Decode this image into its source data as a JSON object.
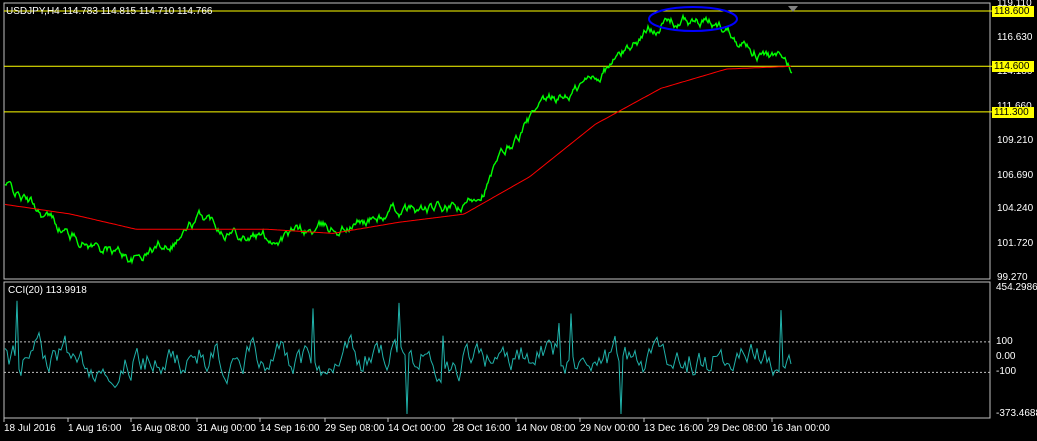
{
  "chart": {
    "symbol_header": "USDJPY,H4  114.783 114.815 114.710 114.766",
    "indicator_header": "CCI(20) 113.9918"
  },
  "price_axis": {
    "ticks": [
      "119.110",
      "116.630",
      "114.180",
      "111.660",
      "109.210",
      "106.690",
      "104.240",
      "101.720",
      "99.270"
    ]
  },
  "horizontal_lines": [
    {
      "label": "118.600",
      "price": 118.6,
      "color": "#ffff00"
    },
    {
      "label": "114.600",
      "price": 114.6,
      "color": "#ffff00"
    },
    {
      "label": "111.300",
      "price": 111.3,
      "color": "#ffff00"
    }
  ],
  "cci_axis": {
    "ticks": [
      "454.2986",
      "100",
      "0.00",
      "-100",
      "-373.4688"
    ]
  },
  "time_axis": {
    "labels": [
      "18 Jul 2016",
      "1 Aug 16:00",
      "16 Aug 08:00",
      "31 Aug 00:00",
      "14 Sep 16:00",
      "29 Sep 08:00",
      "14 Oct 00:00",
      "28 Oct 16:00",
      "14 Nov 08:00",
      "29 Nov 00:00",
      "13 Dec 16:00",
      "29 Dec 08:00",
      "16 Jan 00:00"
    ]
  },
  "colors": {
    "background": "#000000",
    "price_line": "#00ff00",
    "moving_average": "#ff0000",
    "cci_line": "#20b2aa",
    "levels": "#ffff00",
    "annotation": "#0000ff",
    "grid_border": "#c0c0c0"
  },
  "chart_data": {
    "type": "line",
    "title": "USDJPY,H4",
    "x": [
      "18 Jul 2016",
      "1 Aug 16:00",
      "16 Aug 08:00",
      "31 Aug 00:00",
      "14 Sep 16:00",
      "29 Sep 08:00",
      "14 Oct 00:00",
      "28 Oct 16:00",
      "14 Nov 08:00",
      "29 Nov 00:00",
      "13 Dec 16:00",
      "29 Dec 08:00",
      "16 Jan 00:00"
    ],
    "series": [
      {
        "values": [
          106.0,
          102.4,
          100.6,
          103.6,
          102.2,
          102.8,
          104.0,
          104.1,
          110.6,
          113.8,
          118.0,
          117.4,
          114.2
        ]
      },
      {
        "values": [
          104.6,
          103.9,
          102.8,
          102.8,
          102.8,
          102.5,
          103.3,
          103.9,
          106.6,
          110.4,
          113.0,
          114.4,
          114.6
        ]
      }
    ],
    "ylim": [
      99.27,
      119.11
    ],
    "cci_ylim": [
      -373.4688,
      454.2986
    ]
  }
}
